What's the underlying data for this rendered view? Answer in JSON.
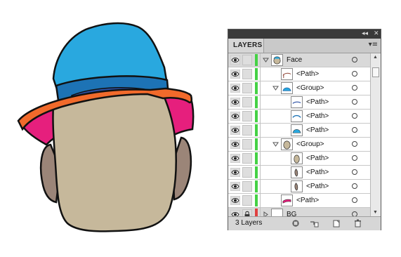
{
  "artwork": {
    "colors": {
      "hat_crown": "#29a8df",
      "hat_band": "#1d73b5",
      "hat_band_inner": "#2a4fa3",
      "brim_top": "#f16a2b",
      "brim_under": "#e61f7d",
      "face": "#c6b89b",
      "ears": "#9b8578",
      "outline": "#111111"
    }
  },
  "panel": {
    "title_icons": [
      "collapse-icon",
      "close-icon"
    ],
    "tab_label": "LAYERS",
    "menu_icon": "panel-menu-icon",
    "rows": [
      {
        "label": "Face",
        "level": 0,
        "twirl": "down",
        "thumb": "face-thumb",
        "color": "#45d145",
        "row_bg": "top",
        "lock": "none"
      },
      {
        "label": "<Path>",
        "level": 1,
        "twirl": "none",
        "thumb": "line-thumb",
        "color": "#45d145",
        "row_bg": "plain",
        "lock": "none"
      },
      {
        "label": "<Group>",
        "level": 1,
        "twirl": "down",
        "thumb": "hat-thumb",
        "color": "#45d145",
        "row_bg": "plain",
        "lock": "none"
      },
      {
        "label": "<Path>",
        "level": 2,
        "twirl": "none",
        "thumb": "curve-thumb",
        "color": "#45d145",
        "row_bg": "plain",
        "lock": "none"
      },
      {
        "label": "<Path>",
        "level": 2,
        "twirl": "none",
        "thumb": "arc-thumb",
        "color": "#45d145",
        "row_bg": "plain",
        "lock": "none"
      },
      {
        "label": "<Path>",
        "level": 2,
        "twirl": "none",
        "thumb": "cap-thumb",
        "color": "#45d145",
        "row_bg": "plain",
        "lock": "none"
      },
      {
        "label": "<Group>",
        "level": 1,
        "twirl": "down",
        "thumb": "head-thumb",
        "color": "#45d145",
        "row_bg": "plain",
        "lock": "none"
      },
      {
        "label": "<Path>",
        "level": 2,
        "twirl": "none",
        "thumb": "oval-thumb",
        "color": "#45d145",
        "row_bg": "plain",
        "lock": "none"
      },
      {
        "label": "<Path>",
        "level": 2,
        "twirl": "none",
        "thumb": "ear-thumb",
        "color": "#45d145",
        "row_bg": "plain",
        "lock": "none"
      },
      {
        "label": "<Path>",
        "level": 2,
        "twirl": "none",
        "thumb": "ear-thumb",
        "color": "#45d145",
        "row_bg": "plain",
        "lock": "none"
      },
      {
        "label": "<Path>",
        "level": 1,
        "twirl": "none",
        "thumb": "brim-thumb",
        "color": "#45d145",
        "row_bg": "plain",
        "lock": "none"
      },
      {
        "label": "BG",
        "level": 0,
        "twirl": "right",
        "thumb": "blank-thumb",
        "color": "#e04040",
        "row_bg": "top",
        "lock": "locked"
      }
    ],
    "footer": {
      "count": "3 Layers",
      "buttons": [
        "make-clipping-mask-icon",
        "create-sublayer-icon",
        "create-new-layer-icon",
        "trash-icon"
      ]
    }
  }
}
